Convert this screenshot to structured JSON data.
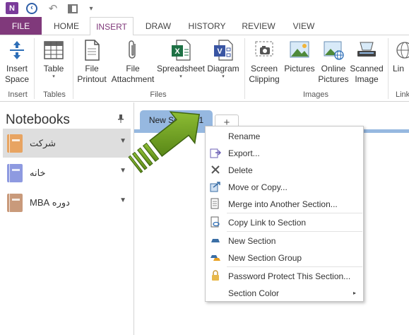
{
  "quick_access": {
    "icons": [
      "onenote-logo",
      "back-arrow-icon",
      "undo-icon",
      "dock-icon",
      "customize-dropdown-icon"
    ],
    "logo_letter": "N"
  },
  "ribbon_tabs": {
    "file": "FILE",
    "home": "HOME",
    "insert": "INSERT",
    "draw": "DRAW",
    "history": "HISTORY",
    "review": "REVIEW",
    "view": "VIEW",
    "active": "INSERT"
  },
  "ribbon": {
    "insert_space": {
      "line1": "Insert",
      "line2": "Space"
    },
    "table": {
      "line1": "Table"
    },
    "file_printout": {
      "line1": "File",
      "line2": "Printout"
    },
    "file_attachment": {
      "line1": "File",
      "line2": "Attachment"
    },
    "spreadsheet": {
      "line1": "Spreadsheet"
    },
    "diagram": {
      "line1": "Diagram"
    },
    "screen_clipping": {
      "line1": "Screen",
      "line2": "Clipping"
    },
    "pictures": {
      "line1": "Pictures"
    },
    "online_pictures": {
      "line1": "Online",
      "line2": "Pictures"
    },
    "scanned_image": {
      "line1": "Scanned",
      "line2": "Image"
    },
    "link_partial": {
      "line1": "Lin"
    },
    "groups": {
      "insert": "Insert",
      "tables": "Tables",
      "files": "Files",
      "images": "Images",
      "links_partial": "Link"
    }
  },
  "navigation": {
    "title": "Notebooks",
    "notebooks": [
      {
        "label": "شرکت",
        "color": "#e8a462",
        "selected": true
      },
      {
        "label": "خانه",
        "color": "#8e9ae0",
        "selected": false
      },
      {
        "label": "دوره MBA",
        "color": "#c99a7b",
        "selected": false
      }
    ]
  },
  "sections": {
    "active_tab": "New Section 1",
    "add_tab": "+",
    "tab_color": "#96b8e0",
    "arrow_color": "#6fa11a"
  },
  "context_menu": {
    "items": [
      {
        "label": "Rename",
        "icon": "none"
      },
      {
        "label": "Export...",
        "icon": "export-icon"
      },
      {
        "label": "Delete",
        "icon": "delete-x-icon"
      },
      {
        "label": "Move or Copy...",
        "icon": "move-copy-icon"
      },
      {
        "label": "Merge into Another Section...",
        "icon": "merge-icon"
      },
      {
        "label": "Copy Link to Section",
        "icon": "copy-link-icon"
      },
      {
        "label": "New Section",
        "icon": "new-section-icon"
      },
      {
        "label": "New Section Group",
        "icon": "new-section-group-icon"
      },
      {
        "label": "Password Protect This Section...",
        "icon": "lock-icon"
      },
      {
        "label": "Section Color",
        "icon": "none",
        "submenu": "▸"
      }
    ]
  }
}
